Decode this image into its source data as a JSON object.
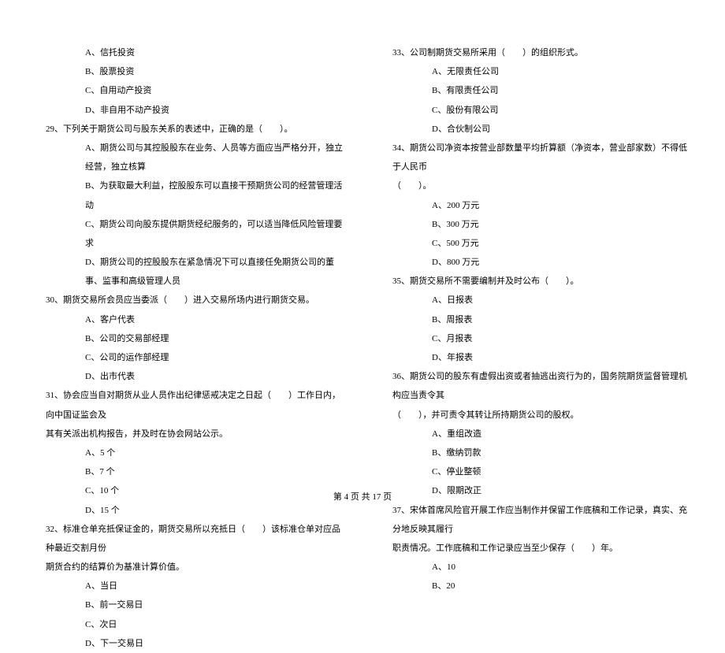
{
  "left": {
    "q28_opts": {
      "a": "A、信托投资",
      "b": "B、股票投资",
      "c": "C、自用动产投资",
      "d": "D、非自用不动产投资"
    },
    "q29": "29、下列关于期货公司与股东关系的表述中，正确的是（　　）。",
    "q29_opts": {
      "a": "A、期货公司与其控股股东在业务、人员等方面应当严格分开，独立经营，独立核算",
      "b": "B、为获取最大利益，控股股东可以直接干预期货公司的经营管理活动",
      "c": "C、期货公司向股东提供期货经纪服务的，可以适当降低风险管理要求",
      "d": "D、期货公司的控股股东在紧急情况下可以直接任免期货公司的董事、监事和高级管理人员"
    },
    "q30": "30、期货交易所会员应当委派（　　）进入交易所场内进行期货交易。",
    "q30_opts": {
      "a": "A、客户代表",
      "b": "B、公司的交易部经理",
      "c": "C、公司的运作部经理",
      "d": "D、出市代表"
    },
    "q31": "31、协会应当自对期货从业人员作出纪律惩戒决定之日起（　　）工作日内，向中国证监会及",
    "q31_cont": "其有关派出机构报告，并及时在协会网站公示。",
    "q31_opts": {
      "a": "A、5 个",
      "b": "B、7 个",
      "c": "C、10 个",
      "d": "D、15 个"
    },
    "q32": "32、标准仓单充抵保证金的，期货交易所以充抵日（　　）该标准仓单对应品种最近交割月份",
    "q32_cont": "期货合约的结算价为基准计算价值。",
    "q32_opts": {
      "a": "A、当日",
      "b": "B、前一交易日",
      "c": "C、次日",
      "d": "D、下一交易日"
    }
  },
  "right": {
    "q33": "33、公司制期货交易所采用（　　）的组织形式。",
    "q33_opts": {
      "a": "A、无限责任公司",
      "b": "B、有限责任公司",
      "c": "C、股份有限公司",
      "d": "D、合伙制公司"
    },
    "q34": "34、期货公司净资本按营业部数量平均折算额（净资本，营业部家数）不得低于人民币",
    "q34_cont": "（　　）。",
    "q34_opts": {
      "a": "A、200 万元",
      "b": "B、300 万元",
      "c": "C、500 万元",
      "d": "D、800 万元"
    },
    "q35": "35、期货交易所不需要编制并及时公布（　　）。",
    "q35_opts": {
      "a": "A、日报表",
      "b": "B、周报表",
      "c": "C、月报表",
      "d": "D、年报表"
    },
    "q36": "36、期货公司的股东有虚假出资或者抽逃出资行为的，国务院期货监督管理机构应当责令其",
    "q36_cont": "（　　），并可责令其转让所持期货公司的股权。",
    "q36_opts": {
      "a": "A、重组改造",
      "b": "B、缴纳罚款",
      "c": "C、停业整顿",
      "d": "D、限期改正"
    },
    "q37": "37、宋体首席风险官开展工作应当制作并保留工作底稿和工作记录，真实、充分地反映其履行",
    "q37_cont": "职责情况。工作底稿和工作记录应当至少保存（　　）年。",
    "q37_opts": {
      "a": "A、10",
      "b": "B、20"
    }
  },
  "footer": "第 4 页 共 17 页"
}
